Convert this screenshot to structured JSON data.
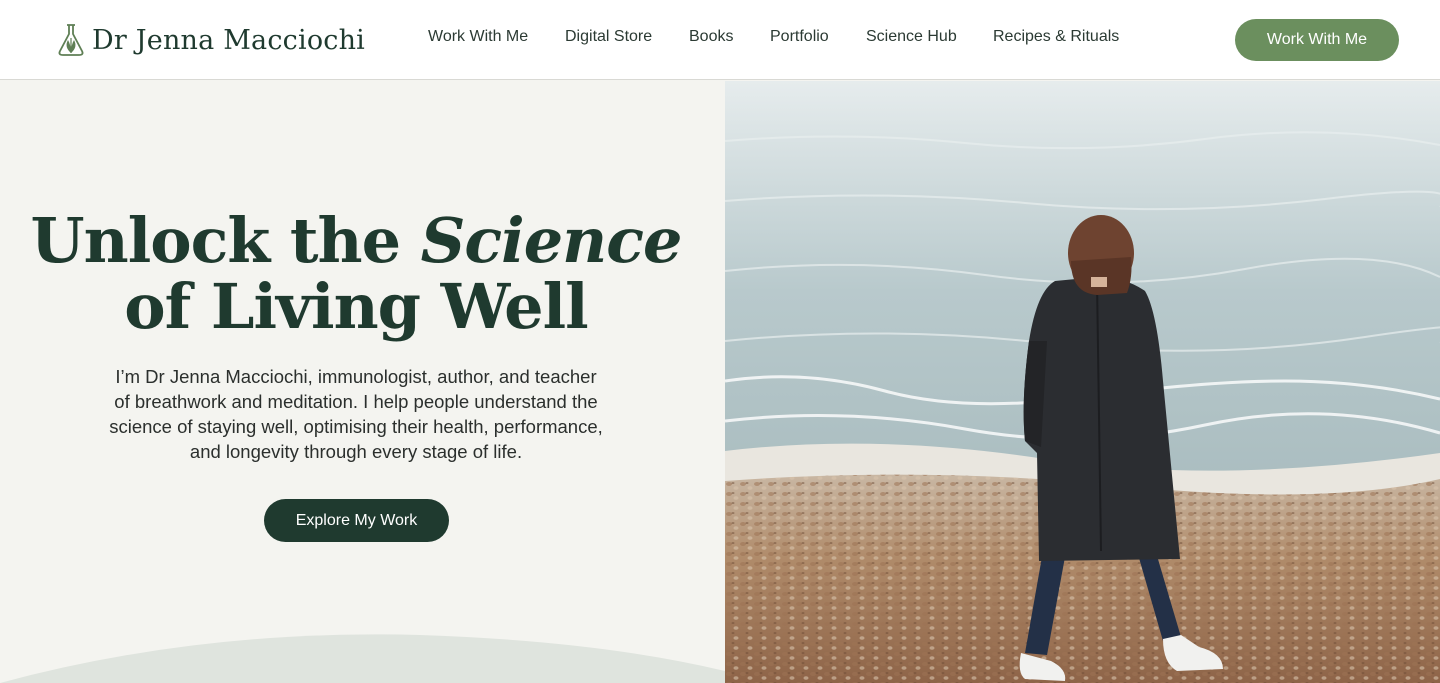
{
  "header": {
    "logo": {
      "text": "Dr Jenna Macciochi",
      "icon": "leaf-flask-icon"
    },
    "nav": [
      {
        "label": "Work With Me"
      },
      {
        "label": "Digital Store"
      },
      {
        "label": "Books"
      },
      {
        "label": "Portfolio"
      },
      {
        "label": "Science Hub"
      },
      {
        "label": "Recipes & Rituals"
      }
    ],
    "cta_label": "Work With Me"
  },
  "hero": {
    "headline_part1": "Unlock the ",
    "headline_emphasis": "Science",
    "headline_part2": "of Living Well",
    "intro": "I’m Dr Jenna Macciochi, immunologist, author, and teacher of breathwork and meditation. I help people understand the science of staying well, optimising their health, performance, and longevity through every stage of life.",
    "button_label": "Explore My Work",
    "image": "woman-walking-on-pebble-beach-photo"
  },
  "colors": {
    "brand_dark_green": "#1f3a2f",
    "brand_sage": "#6b8f5e",
    "background": "#f4f4f0",
    "hill": "#dfe4de"
  }
}
